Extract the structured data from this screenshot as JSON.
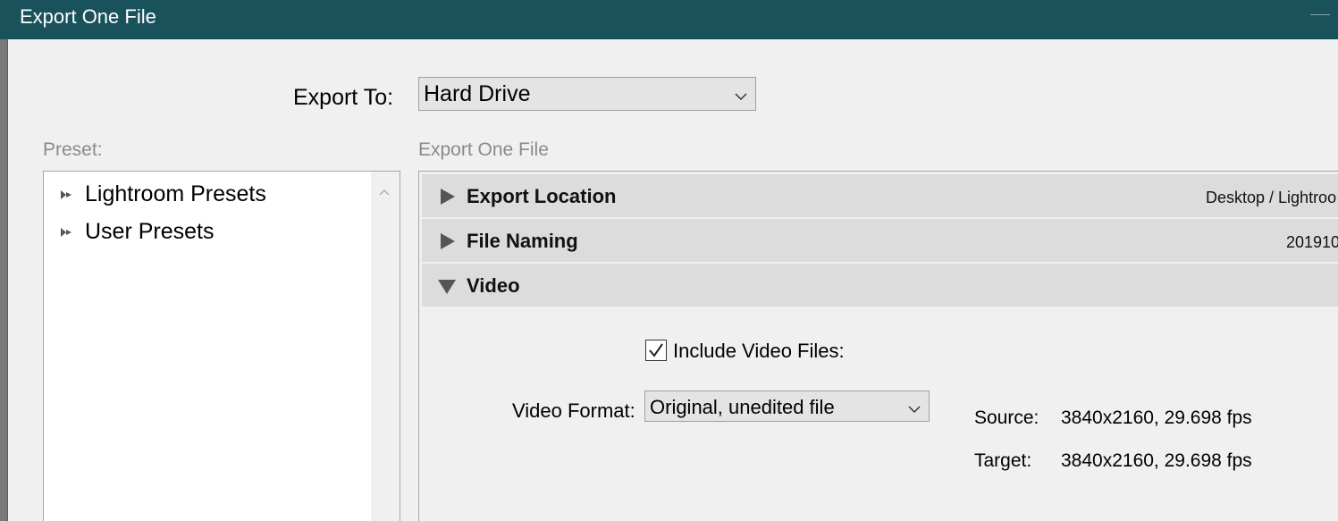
{
  "window": {
    "title": "Export One File"
  },
  "export_to": {
    "label": "Export To:",
    "value": "Hard Drive"
  },
  "preset": {
    "label": "Preset:",
    "items": [
      {
        "label": "Lightroom Presets"
      },
      {
        "label": "User Presets"
      }
    ]
  },
  "panel": {
    "label": "Export One File",
    "sections": [
      {
        "title": "Export Location",
        "summary": "Desktop / Lightroo",
        "expanded": false
      },
      {
        "title": "File Naming",
        "summary": "201910",
        "expanded": false
      },
      {
        "title": "Video",
        "summary": "",
        "expanded": true
      }
    ]
  },
  "video": {
    "include_label": "Include Video Files:",
    "include_checked": true,
    "format_label": "Video Format:",
    "format_value": "Original, unedited file",
    "source_label": "Source:",
    "source_value": "3840x2160, 29.698 fps",
    "target_label": "Target:",
    "target_value": "3840x2160, 29.698 fps"
  },
  "colors": {
    "titlebar": "#1a525c",
    "section_header": "#dcdcdc",
    "window_bg": "#f0f0f0"
  }
}
